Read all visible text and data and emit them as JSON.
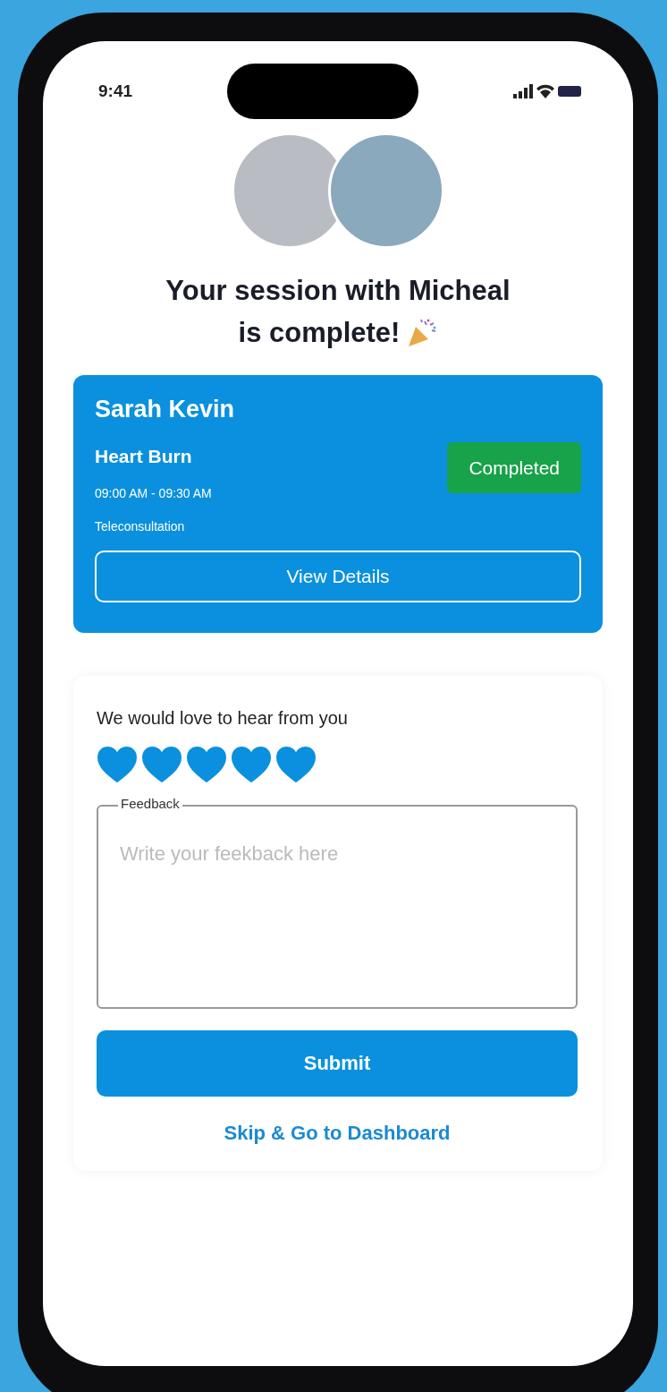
{
  "status_bar": {
    "time": "9:41"
  },
  "title_lines": [
    "Your session with Micheal",
    "is complete!"
  ],
  "appointment": {
    "patient": "Sarah Kevin",
    "condition": "Heart Burn",
    "time": "09:00 AM - 09:30 AM",
    "type": "Teleconsultation",
    "status": "Completed",
    "button": "View Details"
  },
  "feedback": {
    "heading": "We would love to hear from you",
    "stars": 5,
    "field_label": "Feedback",
    "placeholder": "Write your feekback here",
    "submit": "Submit",
    "skip_link": "Skip & Go to Dashboard"
  }
}
